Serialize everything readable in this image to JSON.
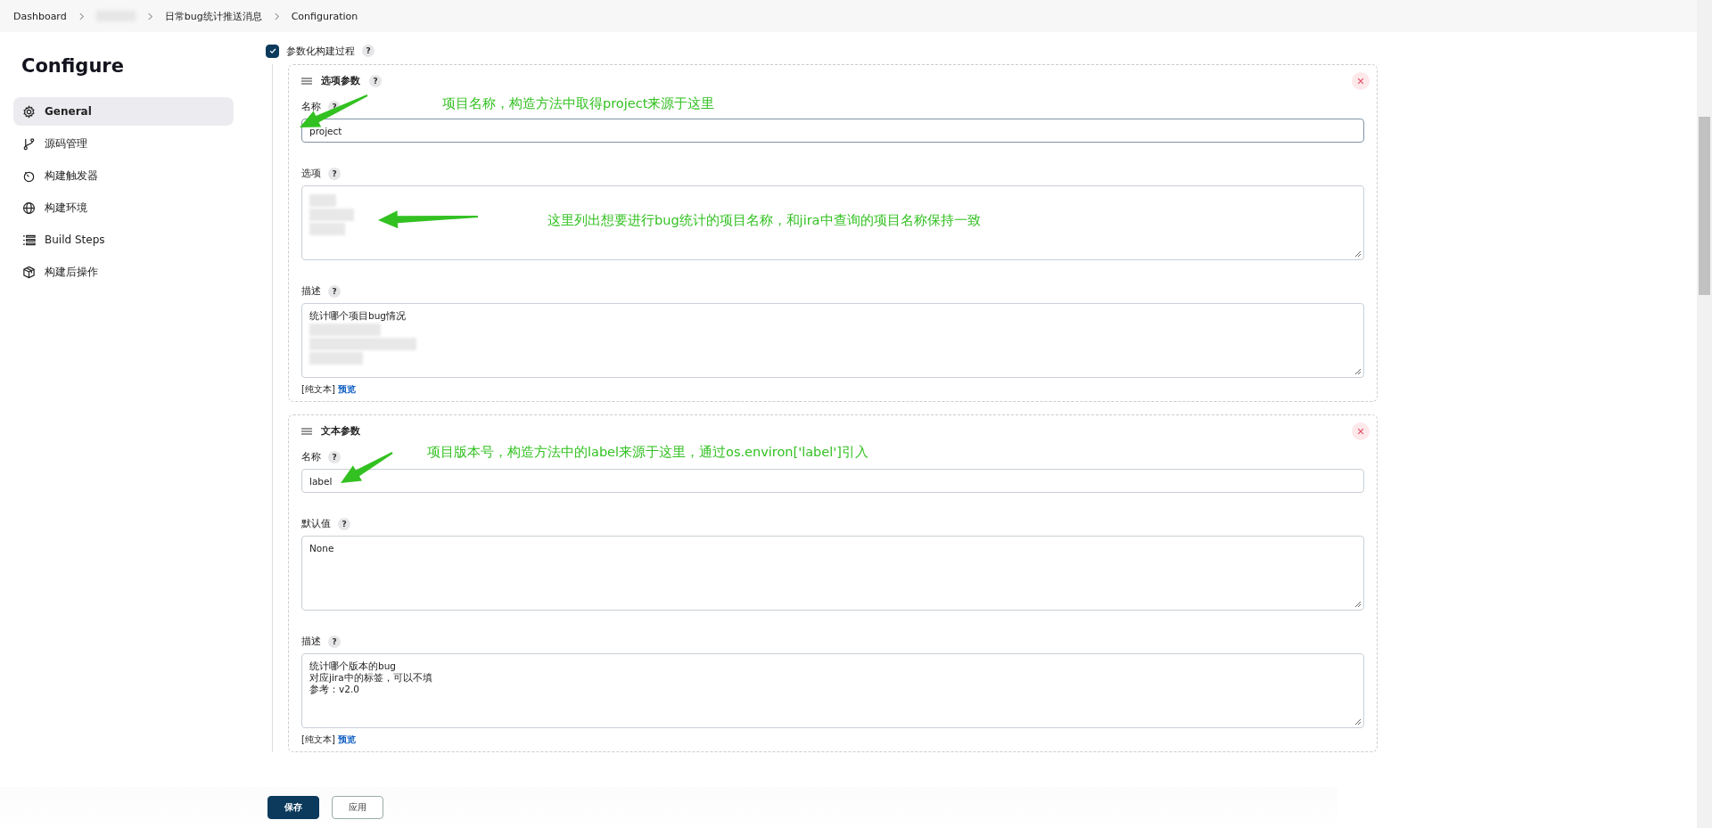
{
  "breadcrumbs": [
    {
      "kind": "link",
      "text": "Dashboard"
    },
    {
      "kind": "blurred"
    },
    {
      "kind": "link",
      "text": "日常bug统计推送消息"
    },
    {
      "kind": "link",
      "text": "Configuration"
    }
  ],
  "sidebar": {
    "title": "Configure",
    "items": [
      {
        "label": "General",
        "selected": true
      },
      {
        "label": "源码管理",
        "selected": false
      },
      {
        "label": "构建触发器",
        "selected": false
      },
      {
        "label": "构建环境",
        "selected": false
      },
      {
        "label": "Build Steps",
        "selected": false
      },
      {
        "label": "构建后操作",
        "selected": false
      }
    ]
  },
  "parameterized": {
    "label": "参数化构建过程",
    "checked": true,
    "help": "?"
  },
  "parameters": [
    {
      "title": "选项参数",
      "help": "?",
      "fields": [
        {
          "label": "名称",
          "help": "?",
          "kind": "input",
          "value": "project",
          "focused": true,
          "annotation": "项目名称，构造方法中取得project来源于这里"
        },
        {
          "label": "选项",
          "help": "?",
          "kind": "textarea",
          "blurred": true,
          "annotation": "这里列出想要进行bug统计的项目名称，和jira中查询的项目名称保持一致"
        },
        {
          "label": "描述",
          "help": "?",
          "kind": "textarea",
          "lines": [
            "统计哪个项目bug情况"
          ],
          "blurred": true
        }
      ],
      "footer": {
        "note": "[纯文本]",
        "link": "预览"
      }
    },
    {
      "title": "文本参数",
      "fields": [
        {
          "label": "名称",
          "help": "?",
          "kind": "input",
          "value": "label",
          "focused": false,
          "annotation": "项目版本号，构造方法中的label来源于这里，通过os.environ['label']引入"
        },
        {
          "label": "默认值",
          "help": "?",
          "kind": "textarea",
          "lines": [
            "None"
          ],
          "blurred": false
        },
        {
          "label": "描述",
          "help": "?",
          "kind": "textarea",
          "lines": [
            "统计哪个版本的bug",
            "对应jira中的标签，可以不填",
            "参考：v2.0"
          ],
          "blurred": false
        }
      ],
      "footer": {
        "note": "[纯文本]",
        "link": "预览"
      }
    }
  ],
  "buttons": [
    {
      "label": "保存",
      "kind": "primary"
    },
    {
      "label": "应用",
      "kind": "secondary"
    }
  ]
}
